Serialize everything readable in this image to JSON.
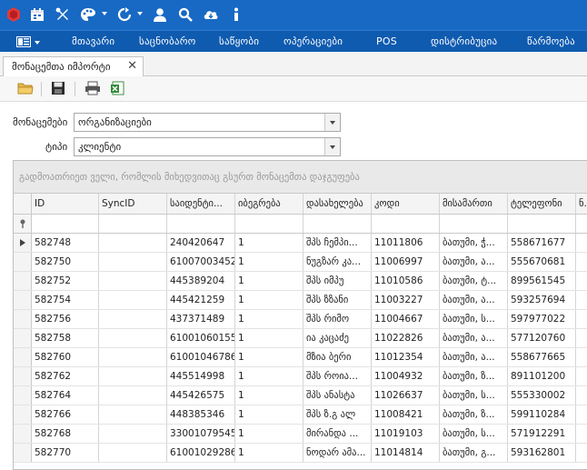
{
  "toolbar": {
    "icons": [
      "app-logo-icon",
      "calendar-icon",
      "tools-icon",
      "palette-icon",
      "refresh-icon",
      "user-icon",
      "search-icon",
      "cloud-download-icon",
      "info-icon"
    ]
  },
  "menu": {
    "items": [
      "მთავარი",
      "საცნობარო",
      "საწყობი",
      "ოპერაციები",
      "POS",
      "დისტრიბუცია",
      "წარმოება"
    ]
  },
  "tab": {
    "label": "მონაცემთა იმპორტი",
    "close": "✕"
  },
  "form": {
    "data_label": "მონაცემები",
    "data_value": "ორგანიზაციები",
    "type_label": "ტიპი",
    "type_value": "კლიენტი"
  },
  "grid": {
    "group_hint": "გადმოათრიეთ ველი, რომლის მიხედვითაც გსურთ მონაცემთა დაჯგუფება",
    "columns": [
      "ID",
      "SyncID",
      "საიდენტი...",
      "იბეგრება",
      "დასახელება",
      "კოდი",
      "მისამართი",
      "ტელეფონი",
      "ნ..."
    ],
    "rows": [
      [
        "582748",
        "",
        "240420647",
        "1",
        "შპს ჩემპი...",
        "11011806",
        "ბათუმი, ჭ...",
        "558671677"
      ],
      [
        "582750",
        "",
        "61007003452",
        "1",
        "ნუგზარ კა...",
        "11006997",
        "ბათუმი, ა...",
        "555670681"
      ],
      [
        "582752",
        "",
        "445389204",
        "1",
        "შპს იმპუ",
        "11010586",
        "ბათუმი, ტ...",
        "899561545"
      ],
      [
        "582754",
        "",
        "445421259",
        "1",
        "შპს ზზანი",
        "11003227",
        "ბათუმი, ა...",
        "593257694"
      ],
      [
        "582756",
        "",
        "437371489",
        "1",
        "შპს რიმო",
        "11004667",
        "ბათუმი, ს...",
        "597977022"
      ],
      [
        "582758",
        "",
        "61001060155",
        "1",
        "ია კაცაძე",
        "11022826",
        "ბათუმი, ა...",
        "577120760"
      ],
      [
        "582760",
        "",
        "61001046786",
        "1",
        "მზია ბერი",
        "11012354",
        "ბათუმი, ა...",
        "558677665"
      ],
      [
        "582762",
        "",
        "445514998",
        "1",
        "შპს როია...",
        "11004932",
        "ბათუმი, ზ...",
        "891101200"
      ],
      [
        "582764",
        "",
        "445426575",
        "1",
        "შპს ანასტა",
        "11026637",
        "ბათუმი, ს...",
        "555330002"
      ],
      [
        "582766",
        "",
        "448385346",
        "1",
        "შპს ზ.გ ალ",
        "11008421",
        "ბათუმი, ზ...",
        "599110284"
      ],
      [
        "582768",
        "",
        "33001079545",
        "1",
        "მირანდა ...",
        "11019103",
        "ბათუმი, ს...",
        "571912291"
      ],
      [
        "582770",
        "",
        "61001029286",
        "1",
        "ნოდარ ამა...",
        "11014814",
        "ბათუმი, გ...",
        "593162801"
      ]
    ]
  }
}
